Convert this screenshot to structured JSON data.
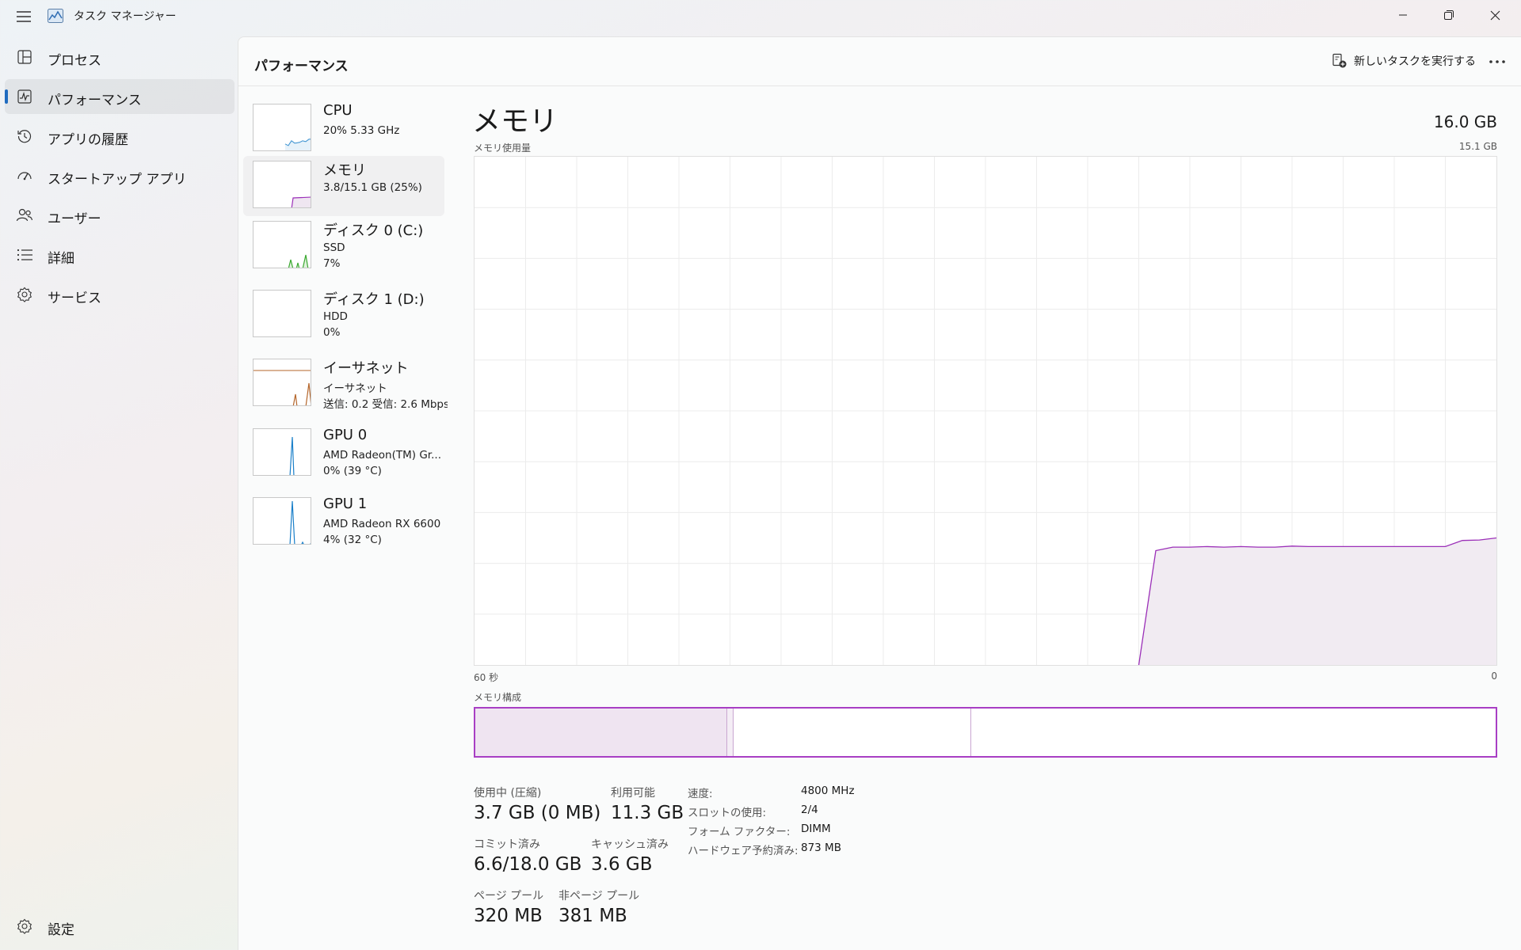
{
  "window": {
    "title": "タスク マネージャー"
  },
  "nav": {
    "items": [
      {
        "label": "プロセス",
        "icon": "processes-icon"
      },
      {
        "label": "パフォーマンス",
        "icon": "performance-icon"
      },
      {
        "label": "アプリの履歴",
        "icon": "app-history-icon"
      },
      {
        "label": "スタートアップ アプリ",
        "icon": "startup-icon"
      },
      {
        "label": "ユーザー",
        "icon": "users-icon"
      },
      {
        "label": "詳細",
        "icon": "details-icon"
      },
      {
        "label": "サービス",
        "icon": "services-icon"
      }
    ],
    "settings_label": "設定",
    "active_index": 1
  },
  "header": {
    "title": "パフォーマンス",
    "run_task_label": "新しいタスクを実行する"
  },
  "devices": [
    {
      "name": "CPU",
      "line1": "20%  5.33 GHz",
      "line2": "",
      "color": "#1a7fc9"
    },
    {
      "name": "メモリ",
      "line1": "3.8/15.1 GB (25%)",
      "line2": "",
      "color": "#9b2fb8"
    },
    {
      "name": "ディスク 0 (C:)",
      "line1": "SSD",
      "line2": "7%",
      "color": "#3aa830"
    },
    {
      "name": "ディスク 1 (D:)",
      "line1": "HDD",
      "line2": "0%",
      "color": "#3aa830"
    },
    {
      "name": "イーサネット",
      "line1": "イーサネット",
      "line2": "送信: 0.2  受信: 2.6 Mbps",
      "color": "#b4652a"
    },
    {
      "name": "GPU 0",
      "line1": "AMD Radeon(TM) Gr...",
      "line2": "0% (39 °C)",
      "color": "#1a7fc9"
    },
    {
      "name": "GPU 1",
      "line1": "AMD Radeon RX 6600",
      "line2": "4% (32 °C)",
      "color": "#1a7fc9"
    }
  ],
  "memory": {
    "title": "メモリ",
    "total": "16.0 GB",
    "usage_label": "メモリ使用量",
    "usage_max": "15.1 GB",
    "axis_left": "60 秒",
    "axis_right": "0",
    "composition_label": "メモリ構成",
    "accent": "#9b2fb8",
    "usage_history_fraction": [
      0,
      0,
      0,
      0,
      0,
      0,
      0,
      0,
      0,
      0,
      0,
      0,
      0,
      0,
      0,
      0,
      0,
      0,
      0,
      0,
      0,
      0,
      0,
      0,
      0,
      0,
      0,
      0,
      0,
      0,
      0,
      0,
      0,
      0,
      0,
      0,
      0,
      0,
      0,
      0,
      0.225,
      0.232,
      0.232,
      0.233,
      0.232,
      0.233,
      0.232,
      0.232,
      0.234,
      0.233,
      0.233,
      0.233,
      0.233,
      0.233,
      0.233,
      0.233,
      0.233,
      0.233,
      0.245,
      0.246,
      0.25
    ],
    "stats": {
      "in_use_label": "使用中 (圧縮)",
      "in_use": "3.7 GB (0 MB)",
      "available_label": "利用可能",
      "available": "11.3 GB",
      "committed_label": "コミット済み",
      "committed": "6.6/18.0 GB",
      "cached_label": "キャッシュ済み",
      "cached": "3.6 GB",
      "paged_label": "ページ プール",
      "paged": "320 MB",
      "nonpaged_label": "非ページ プール",
      "nonpaged": "381 MB"
    },
    "specs": [
      {
        "label": "速度:",
        "value": "4800 MHz"
      },
      {
        "label": "スロットの使用:",
        "value": "2/4"
      },
      {
        "label": "フォーム ファクター:",
        "value": "DIMM"
      },
      {
        "label": "ハードウェア予約済み:",
        "value": "873 MB"
      }
    ]
  }
}
